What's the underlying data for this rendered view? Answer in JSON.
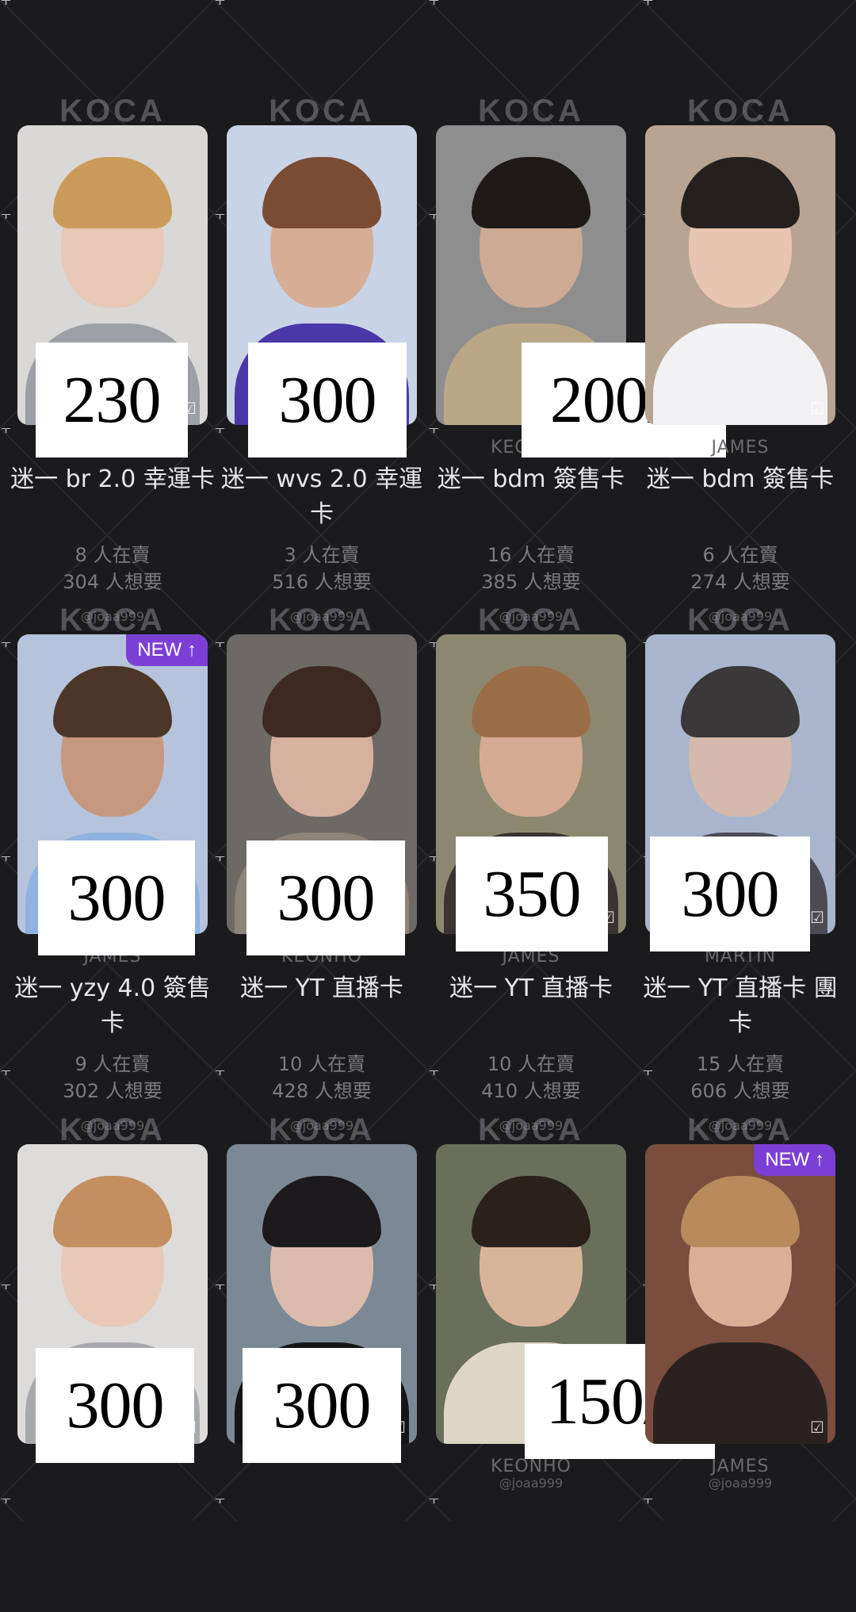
{
  "watermark_logo": "KOCA",
  "handle": "@joaa999",
  "cards": [
    {
      "price": "230",
      "member": "",
      "title": "迷一 br 2.0 幸運卡",
      "sellers": "8 人在賣",
      "wanters": "304 人想要",
      "new": false,
      "colors": {
        "bg": "#d9d8d6",
        "hair": "#c99a5a",
        "skin": "#e9c7b4",
        "cloth": "#9aa0a6"
      }
    },
    {
      "price": "300",
      "member": "",
      "title": "迷一 wvs 2.0 幸運卡",
      "sellers": "3 人在賣",
      "wanters": "516 人想要",
      "new": false,
      "colors": {
        "bg": "#c9d3e6",
        "hair": "#7a4c34",
        "skin": "#d7a88c",
        "cloth": "#4a37a8"
      }
    },
    {
      "price": "200/1",
      "member": "KEONHO",
      "title": "迷一 bdm 簽售卡",
      "sellers": "16 人在賣",
      "wanters": "385 人想要",
      "new": false,
      "colors": {
        "bg": "#8e8e8e",
        "hair": "#1f1a18",
        "skin": "#d4ad95",
        "cloth": "#b9a786"
      }
    },
    {
      "price": "",
      "member": "JAMES",
      "title": "迷一 bdm 簽售卡",
      "sellers": "6 人在賣",
      "wanters": "274 人想要",
      "new": false,
      "colors": {
        "bg": "#b7a492",
        "hair": "#24201e",
        "skin": "#ecc9b6",
        "cloth": "#f2f2f4"
      }
    },
    {
      "price": "300",
      "member": "JAMES",
      "title": "迷一 yzy 4.0 簽售卡",
      "sellers": "9 人在賣",
      "wanters": "302 人想要",
      "new": true,
      "colors": {
        "bg": "#b6c3dc",
        "hair": "#4c3628",
        "skin": "#c99476",
        "cloth": "#8fb2e0"
      }
    },
    {
      "price": "300",
      "member": "KEONHO",
      "title": "迷一 YT 直播卡",
      "sellers": "10 人在賣",
      "wanters": "428 人想要",
      "new": false,
      "colors": {
        "bg": "#6d6a66",
        "hair": "#3c2a22",
        "skin": "#e2b9a5",
        "cloth": "#8f8479"
      }
    },
    {
      "price": "350",
      "member": "JAMES",
      "title": "迷一 YT 直播卡",
      "sellers": "10 人在賣",
      "wanters": "410 人想要",
      "new": false,
      "colors": {
        "bg": "#8c8870",
        "hair": "#9c6e48",
        "skin": "#dcae97",
        "cloth": "#3b3432"
      }
    },
    {
      "price": "300",
      "member": "MARTIN",
      "title": "迷一 YT 直播卡 團卡",
      "sellers": "15 人在賣",
      "wanters": "606 人想要",
      "new": false,
      "colors": {
        "bg": "#a9b5cc",
        "hair": "#3a3838",
        "skin": "#d8b9a8",
        "cloth": "#4c4a55"
      }
    },
    {
      "price": "300",
      "member": "",
      "title": "",
      "sellers": "",
      "wanters": "",
      "new": false,
      "colors": {
        "bg": "#dedcdb",
        "hair": "#c48f60",
        "skin": "#eac6b4",
        "cloth": "#a7a9ad"
      }
    },
    {
      "price": "300",
      "member": "",
      "title": "",
      "sellers": "",
      "wanters": "",
      "new": false,
      "colors": {
        "bg": "#7d8895",
        "hair": "#1c1a1c",
        "skin": "#e4c1ae",
        "cloth": "#151517"
      }
    },
    {
      "price": "150/1",
      "member": "KEONHO",
      "title": "",
      "sellers": "",
      "wanters": "",
      "new": false,
      "colors": {
        "bg": "#6a6f5c",
        "hair": "#2a211d",
        "skin": "#e4bba2",
        "cloth": "#ddd5c5"
      }
    },
    {
      "price": "",
      "member": "JAMES",
      "title": "",
      "sellers": "",
      "wanters": "",
      "new": true,
      "colors": {
        "bg": "#7a4d3e",
        "hair": "#b98a5c",
        "skin": "#e5b9a0",
        "cloth": "#2b2220"
      }
    }
  ],
  "new_badge_label": "NEW ↑",
  "check_glyph": "☑"
}
